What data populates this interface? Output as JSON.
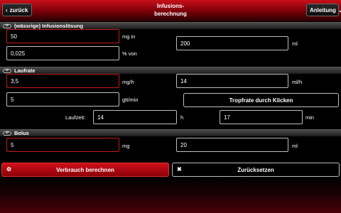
{
  "header": {
    "back_label": "zurück",
    "title_line1": "Infusions-",
    "title_line2": "berechnung",
    "help_label": "Anleitung"
  },
  "section_infusion": {
    "pill": "⊘",
    "title": "(wässrige) Infusionslösung",
    "amount_value": "50",
    "amount_unit": "mg in",
    "percent_value": "0,025",
    "percent_unit": "% von",
    "volume_value": "200",
    "volume_unit": "ml"
  },
  "section_rate": {
    "pill": "⊘",
    "title": "Laufrate",
    "mgh_value": "3,5",
    "mgh_unit": "mg/h",
    "mlh_value": "14",
    "mlh_unit": "ml/h",
    "gtt_value": "5",
    "gtt_unit": "gtt/min",
    "drip_button": "Tropfrate durch Klicken",
    "runtime_label": "Laufzeit:",
    "hours_value": "14",
    "hours_unit": "h",
    "minutes_value": "17",
    "minutes_unit": "min"
  },
  "section_bolus": {
    "pill": "⊘",
    "title": "Bolus",
    "mg_value": "5",
    "mg_unit": "mg",
    "ml_value": "20",
    "ml_unit": "ml"
  },
  "actions": {
    "calculate_label": "Verbrauch berechnen",
    "reset_label": "Zurücksetzen",
    "calculate_icon": "⚙",
    "reset_icon": "✖"
  }
}
